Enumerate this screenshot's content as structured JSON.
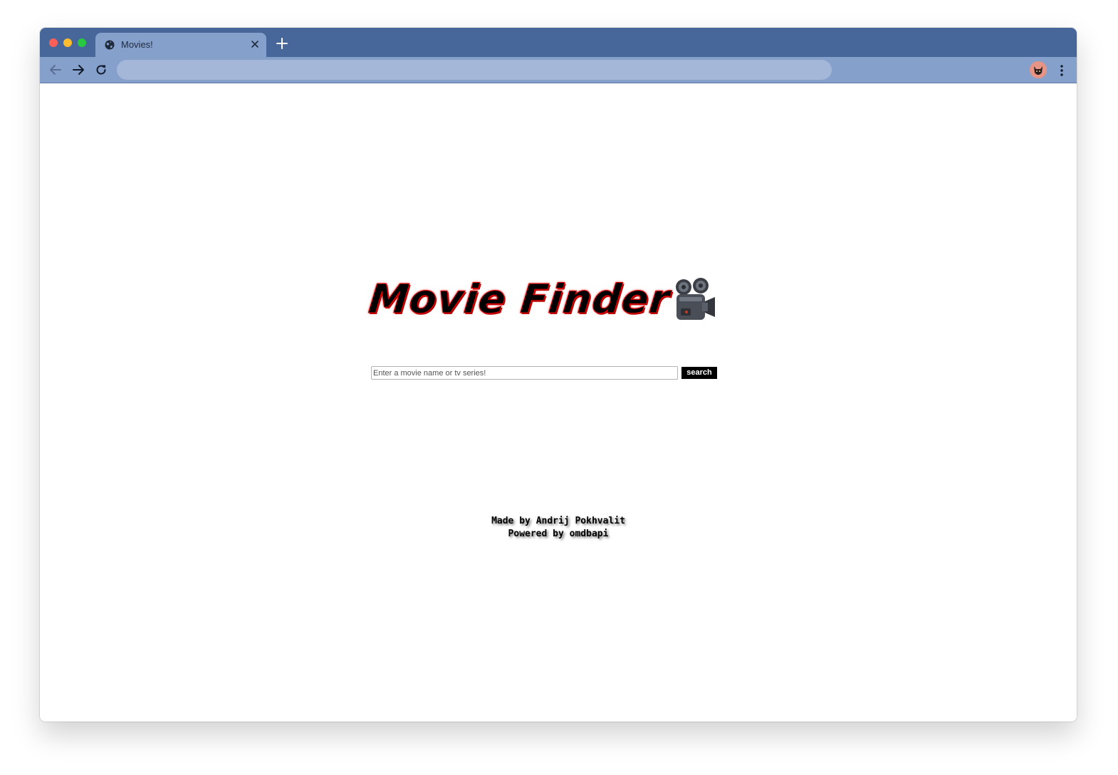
{
  "browser": {
    "tab": {
      "title": "Movies!",
      "favicon": "globe-icon",
      "close_icon": "close-icon"
    },
    "new_tab_icon": "plus-icon",
    "toolbar": {
      "back_icon": "arrow-left-icon",
      "forward_icon": "arrow-right-icon",
      "reload_icon": "reload-icon",
      "address": "",
      "profile_icon": "avatar",
      "menu_icon": "kebab-menu-icon"
    },
    "colors": {
      "tabbar": "#47679b",
      "toolbar": "#86a0cc",
      "omnibox": "#a4b7d9"
    }
  },
  "page": {
    "logo_text": "Movie Finder",
    "logo_icon": "movie-camera-icon",
    "search": {
      "placeholder": "Enter a movie name or tv series!",
      "value": "",
      "button_label": "search"
    },
    "footer": {
      "line1": "Made by Andrij Pokhvalit",
      "line2": "Powered by omdbapi"
    },
    "colors": {
      "logo_text": "#000000",
      "logo_outline": "#e00000",
      "button_bg": "#000000",
      "button_text": "#ffffff"
    }
  }
}
